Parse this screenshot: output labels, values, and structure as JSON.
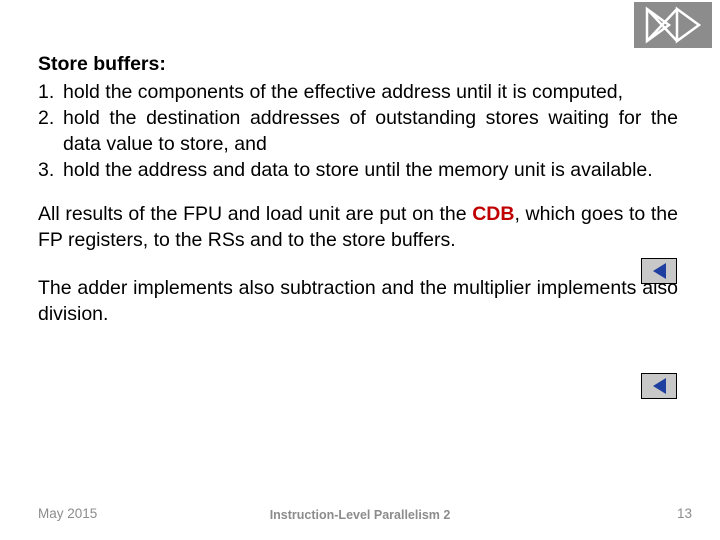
{
  "logo": {
    "icon": "logo-monogram",
    "bg_color": "#8c8c8c"
  },
  "slide": {
    "heading": "Store buffers:",
    "list": [
      {
        "num": "1.",
        "text": "hold the components of the effective address until it is computed,"
      },
      {
        "num": "2.",
        "text": "hold the destination addresses of outstanding stores waiting for the data value to store, and"
      },
      {
        "num": "3.",
        "text": "hold the address and data to store until the memory unit is available."
      }
    ],
    "paragraph_1_before": "All results of the FPU and load unit are put on the ",
    "paragraph_1_highlight": "CDB",
    "paragraph_1_after": ", which goes to the FP registers, to the RSs and to the store buffers.",
    "paragraph_2": "The adder implements also subtraction and the multiplier implements also division.",
    "highlight_color": "#c00000"
  },
  "buttons": {
    "back_1": "back-arrow",
    "back_2": "back-arrow"
  },
  "footer": {
    "date": "May 2015",
    "title": "Instruction-Level Parallelism 2",
    "page": "13"
  }
}
